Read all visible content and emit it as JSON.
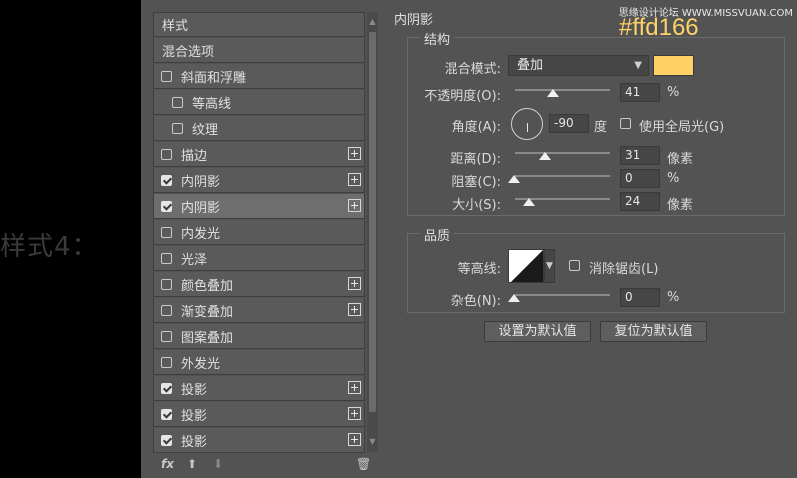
{
  "caption": "样式4：",
  "watermark": "思缘设计论坛 WWW.MISSVUAN.COM",
  "list": {
    "header": "样式",
    "blend_options": "混合选项",
    "items": [
      {
        "label": "斜面和浮雕",
        "checked": false
      },
      {
        "label": "等高线",
        "checked": false
      },
      {
        "label": "纹理",
        "checked": false
      },
      {
        "label": "描边",
        "checked": false
      },
      {
        "label": "内阴影",
        "checked": true
      },
      {
        "label": "内阴影",
        "checked": true
      },
      {
        "label": "内发光",
        "checked": false
      },
      {
        "label": "光泽",
        "checked": false
      },
      {
        "label": "颜色叠加",
        "checked": false
      },
      {
        "label": "渐变叠加",
        "checked": false
      },
      {
        "label": "图案叠加",
        "checked": false
      },
      {
        "label": "外发光",
        "checked": false
      },
      {
        "label": "投影",
        "checked": true
      },
      {
        "label": "投影",
        "checked": true
      },
      {
        "label": "投影",
        "checked": true
      }
    ],
    "fx_label": "fx"
  },
  "panel": {
    "title": "内阴影",
    "structure_title": "结构",
    "blend_mode_label": "混合模式:",
    "blend_mode_value": "叠加",
    "color": "#ffd166",
    "color_hex_label": "#ffd166",
    "opacity_label": "不透明度(O):",
    "opacity_value": "41",
    "opacity_unit": "%",
    "angle_label": "角度(A):",
    "angle_value": "-90",
    "angle_unit": "度",
    "global_light_label": "使用全局光(G)",
    "global_light_checked": false,
    "distance_label": "距离(D):",
    "distance_value": "31",
    "distance_unit": "像素",
    "choke_label": "阻塞(C):",
    "choke_value": "0",
    "choke_unit": "%",
    "size_label": "大小(S):",
    "size_value": "24",
    "size_unit": "像素",
    "quality_title": "品质",
    "contour_label": "等高线:",
    "antialias_label": "消除锯齿(L)",
    "antialias_checked": false,
    "noise_label": "杂色(N):",
    "noise_value": "0",
    "noise_unit": "%",
    "set_default_button": "设置为默认值",
    "reset_default_button": "复位为默认值"
  }
}
